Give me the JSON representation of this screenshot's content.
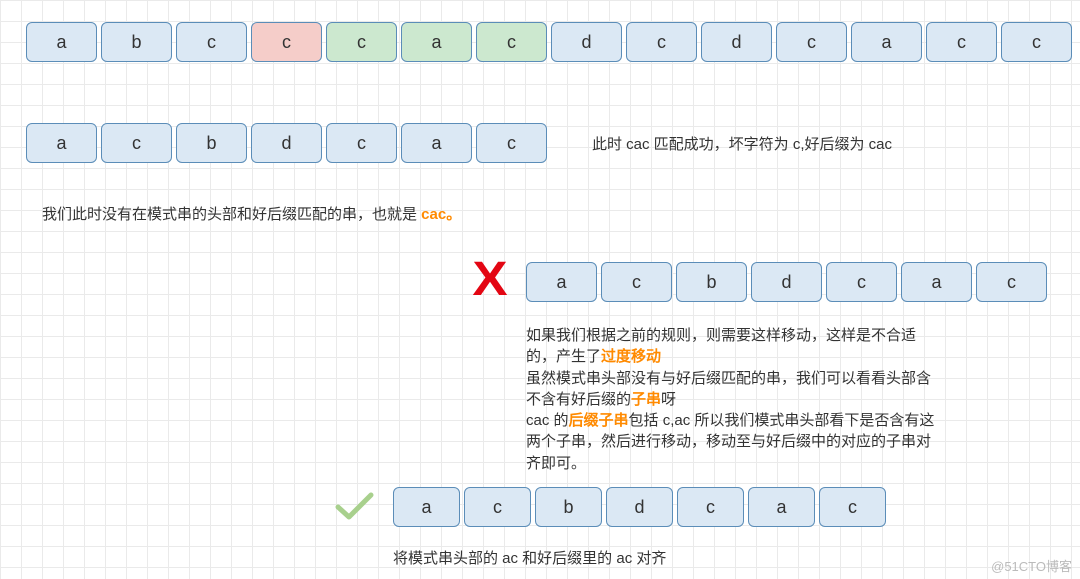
{
  "top_row": [
    "a",
    "b",
    "c",
    "c",
    "c",
    "a",
    "c",
    "d",
    "c",
    "d",
    "c",
    "a",
    "c",
    "c"
  ],
  "top_row_colors": [
    "blue",
    "blue",
    "blue",
    "red",
    "green",
    "green",
    "green",
    "blue",
    "blue",
    "blue",
    "blue",
    "blue",
    "blue",
    "blue"
  ],
  "pattern_row1": [
    "a",
    "c",
    "b",
    "d",
    "c",
    "a",
    "c"
  ],
  "note_right1": "此时 cac 匹配成功，坏字符为 c,好后缀为 cac",
  "note_left": {
    "pre": "我们此时没有在模式串的头部和好后缀匹配的串，也就是 ",
    "highlight": "cac。"
  },
  "pattern_row2": [
    "a",
    "c",
    "b",
    "d",
    "c",
    "a",
    "c"
  ],
  "paragraph": {
    "l1a": "如果我们根据之前的规则，则需要这样移动，这样是不合适",
    "l2a": "的，产生了",
    "l2b": "过度移动",
    "l3a": "虽然模式串头部没有与好后缀匹配的串，我们可以看看头部含",
    "l4a": "不含有好后缀的",
    "l4b": "子串",
    "l4c": "呀",
    "l5a": "cac 的",
    "l5b": "后缀子串",
    "l5c": "包括  c,ac 所以我们模式串头部看下是否含有这",
    "l6a": "两个子串，然后进行移动，移动至与好后缀中的对应的子串对",
    "l7a": "齐即可。"
  },
  "pattern_row3": [
    "a",
    "c",
    "b",
    "d",
    "c",
    "a",
    "c"
  ],
  "bottom_note": "将模式串头部的 ac 和好后缀里的 ac 对齐",
  "watermark": "@51CTO博客"
}
